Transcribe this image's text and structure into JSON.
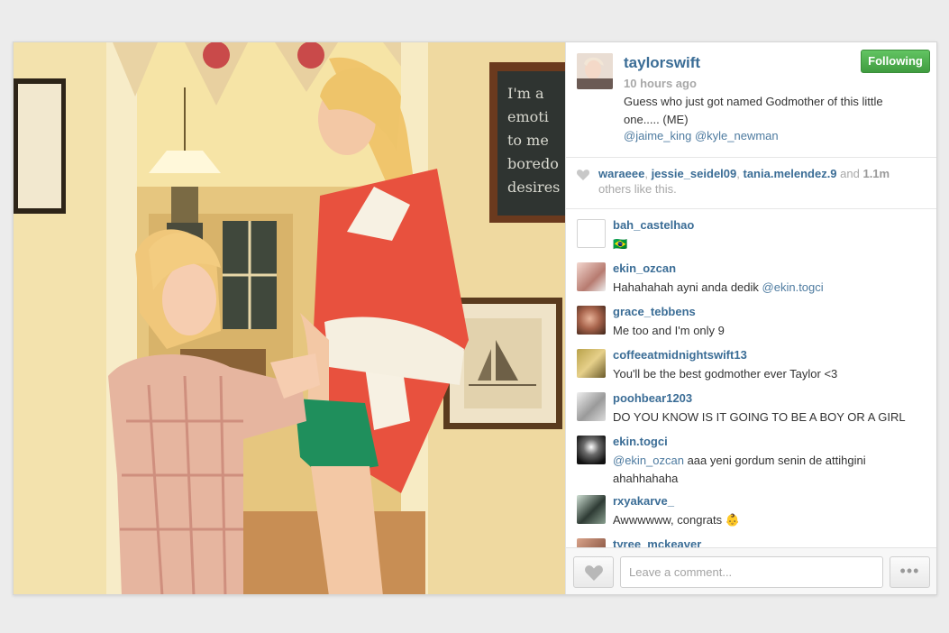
{
  "post": {
    "username": "taylorswift",
    "time": "10 hours ago",
    "caption": "Guess who just got named Godmother of this little one..... (ME)",
    "tags": "@jaime_king @kyle_newman",
    "follow_label": "Following"
  },
  "likes": {
    "names": [
      "waraeee",
      "jessie_seidel09",
      "tania.melendez.9"
    ],
    "and": " and ",
    "count": "1.1m",
    "suffix": "others like this."
  },
  "comments": [
    {
      "user": "bah_castelhao",
      "text": "🇧🇷",
      "mention": "",
      "after": ""
    },
    {
      "user": "ekin_ozcan",
      "text": "Hahahahah ayni anda dedik ",
      "mention": "@ekin.togci",
      "after": ""
    },
    {
      "user": "grace_tebbens",
      "text": "Me too and I'm only 9",
      "mention": "",
      "after": ""
    },
    {
      "user": "coffeeatmidnightswift13",
      "text": "You'll be the best godmother ever Taylor <3",
      "mention": "",
      "after": ""
    },
    {
      "user": "poohbear1203",
      "text": "DO YOU KNOW IS IT GOING TO BE A BOY OR A GIRL",
      "mention": "",
      "after": ""
    },
    {
      "user": "ekin.togci",
      "text": "",
      "mention": "@ekin_ozcan",
      "after": " aaa yeni gordum senin de attihgini ahahhahaha"
    },
    {
      "user": "rxyakarve_",
      "text": "Awwwwww, congrats 👶",
      "mention": "",
      "after": ""
    },
    {
      "user": "tyree_mckeaver",
      "text": "",
      "mention": "",
      "after": ""
    }
  ],
  "footer": {
    "comment_placeholder": "Leave a comment...",
    "more_label": "•••"
  },
  "colors": {
    "link": "#3b6d96",
    "follow_green": "#4cae4c",
    "muted": "#a8a8a8"
  }
}
